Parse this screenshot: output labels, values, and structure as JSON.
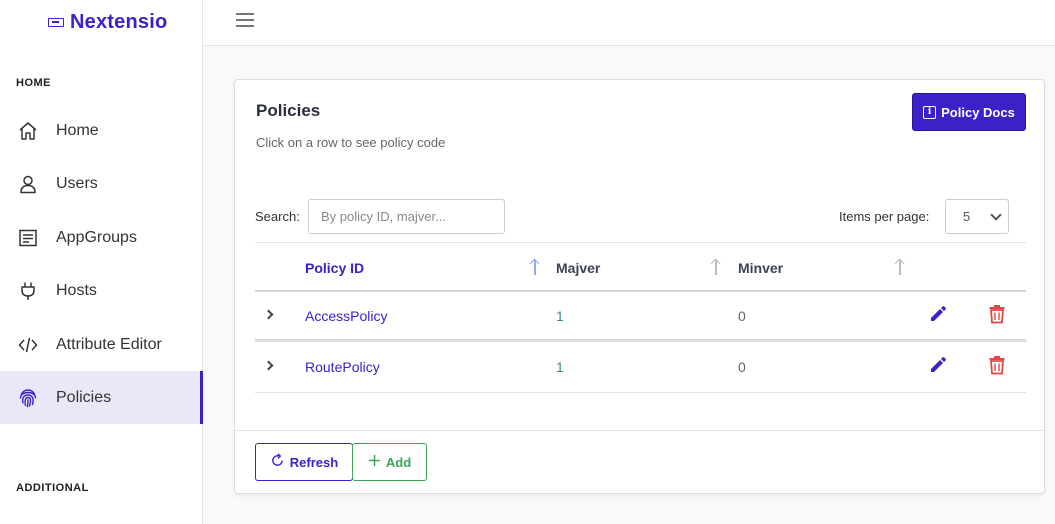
{
  "app": {
    "brand": "Nextensio",
    "brand_icon": "card-icon",
    "accent_color": "#3b22c8"
  },
  "sidebar": {
    "section_home": "HOME",
    "section_additional": "ADDITIONAL",
    "items": [
      {
        "label": "Home",
        "icon": "home-icon"
      },
      {
        "label": "Users",
        "icon": "user-icon"
      },
      {
        "label": "AppGroups",
        "icon": "document-icon"
      },
      {
        "label": "Hosts",
        "icon": "plug-icon"
      },
      {
        "label": "Attribute Editor",
        "icon": "code-icon"
      },
      {
        "label": "Policies",
        "icon": "fingerprint-icon",
        "active": true
      }
    ]
  },
  "topbar": {
    "menu_icon": "hamburger-icon"
  },
  "card": {
    "title": "Policies",
    "subtitle": "Click on a row to see policy code",
    "docs_button": "Policy Docs",
    "search_label": "Search:",
    "search_placeholder": "By policy ID, majver...",
    "items_per_page_label": "Items per page:",
    "items_per_page_value": "5",
    "columns": [
      "Policy ID",
      "Majver",
      "Minver"
    ],
    "rows": [
      {
        "policy_id": "AccessPolicy",
        "majver": "1",
        "minver": "0"
      },
      {
        "policy_id": "RoutePolicy",
        "majver": "1",
        "minver": "0"
      }
    ],
    "refresh_button": "Refresh",
    "add_button": "Add"
  }
}
